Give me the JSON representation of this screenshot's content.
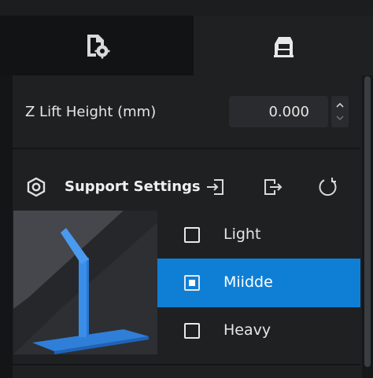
{
  "tabs": [
    {
      "icon": "file-settings-icon",
      "active": false
    },
    {
      "icon": "printer-stand-icon",
      "active": true
    }
  ],
  "z_lift": {
    "label": "Z Lift Height (mm)",
    "value": "0.000"
  },
  "support": {
    "title": "Support Settings",
    "icons": [
      "hexagon-icon",
      "import-icon",
      "export-icon",
      "reset-icon"
    ],
    "options": [
      {
        "label": "Light",
        "selected": false
      },
      {
        "label": "Miidde",
        "selected": true
      },
      {
        "label": "Heavy",
        "selected": false
      }
    ]
  },
  "colors": {
    "background": "#1f2022",
    "accent": "#0f7fd6",
    "support_model": "#3a8ee8"
  }
}
